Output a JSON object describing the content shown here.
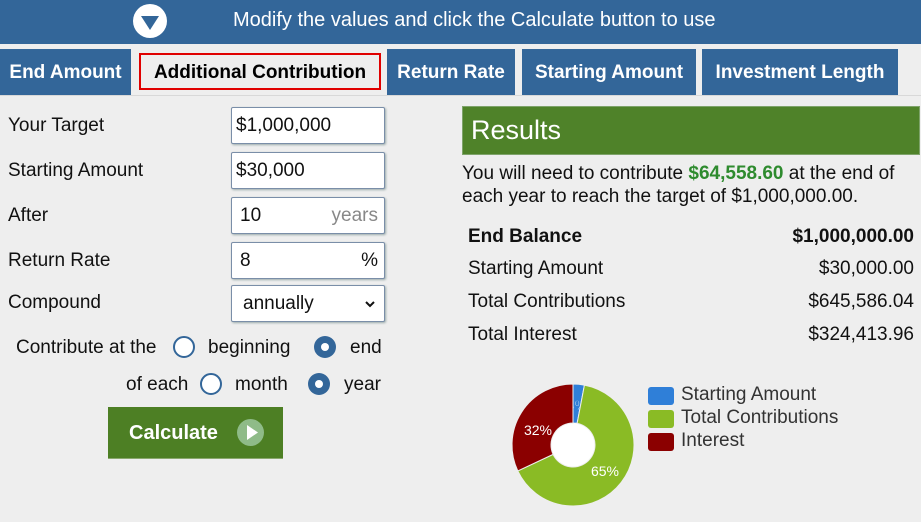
{
  "banner": {
    "icon": "chevron-down-circle-icon",
    "message": "Modify the values and click the Calculate button to use"
  },
  "tabs": [
    {
      "label": "End Amount",
      "active": false
    },
    {
      "label": "Additional Contribution",
      "active": true
    },
    {
      "label": "Return Rate",
      "active": false
    },
    {
      "label": "Starting Amount",
      "active": false
    },
    {
      "label": "Investment Length",
      "active": false
    }
  ],
  "form": {
    "target": {
      "label": "Your Target",
      "value": "$1,000,000"
    },
    "starting_amount": {
      "label": "Starting Amount",
      "value": "$30,000"
    },
    "after": {
      "label": "After",
      "value": "10",
      "suffix": "years"
    },
    "return_rate": {
      "label": "Return Rate",
      "value": "8",
      "suffix": "%"
    },
    "compound": {
      "label": "Compound",
      "selected": "annually"
    },
    "contribute_timing": {
      "label": "Contribute at the",
      "options": [
        {
          "label": "beginning",
          "checked": false
        },
        {
          "label": "end",
          "checked": true
        }
      ]
    },
    "contribute_period": {
      "label": "of each",
      "options": [
        {
          "label": "month",
          "checked": false
        },
        {
          "label": "year",
          "checked": true
        }
      ]
    },
    "calculate_label": "Calculate"
  },
  "results": {
    "title": "Results",
    "summary_prefix": "You will need to contribute ",
    "summary_amount": "$64,558.60",
    "summary_suffix": " at the end of each year to reach the target of $1,000,000.00.",
    "rows": [
      {
        "label": "End Balance",
        "value": "$1,000,000.00",
        "bold": true
      },
      {
        "label": "Starting Amount",
        "value": "$30,000.00",
        "bold": false
      },
      {
        "label": "Total Contributions",
        "value": "$645,586.04",
        "bold": false
      },
      {
        "label": "Total Interest",
        "value": "$324,413.96",
        "bold": false
      }
    ]
  },
  "chart_data": {
    "type": "pie",
    "variant": "donut",
    "categories": [
      "Starting Amount",
      "Total Contributions",
      "Interest"
    ],
    "values": [
      3,
      65,
      32
    ],
    "labels": [
      "3%",
      "65%",
      "32%"
    ],
    "colors": [
      "#2f7fd8",
      "#8abb25",
      "#8b0000"
    ],
    "legend": "right"
  }
}
